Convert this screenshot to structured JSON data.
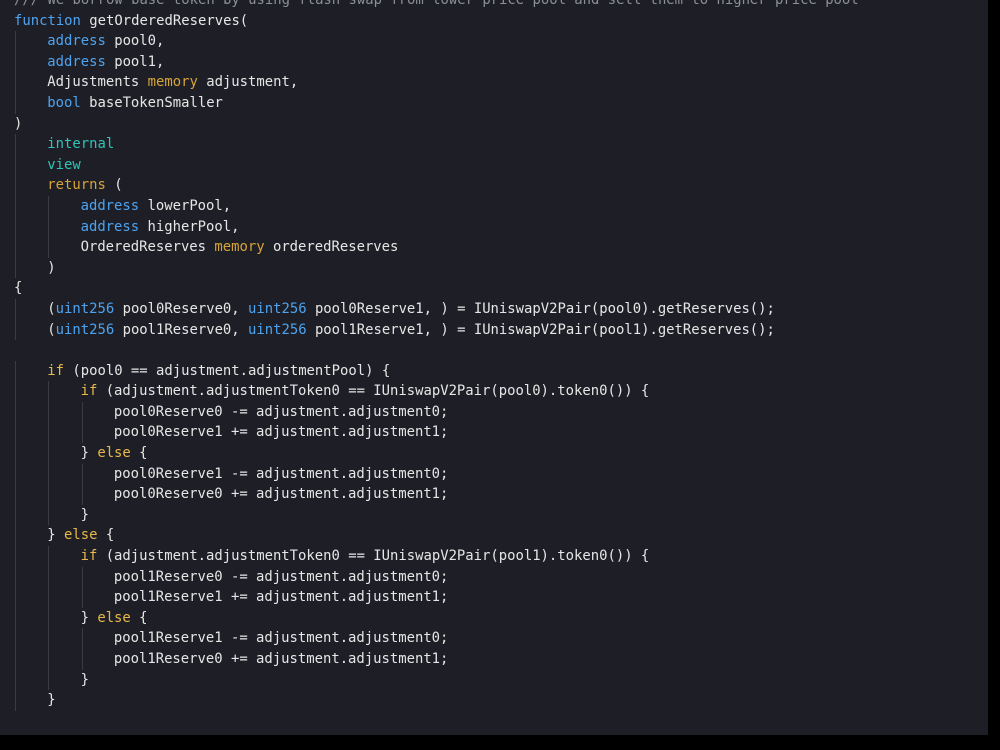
{
  "editor": {
    "language": "Solidity",
    "colors": {
      "background": "#1e1f26",
      "plain": "#e6e6e6",
      "comment": "#8a8f98",
      "function_keyword": "#4da3f0",
      "type_keyword": "#4da3f0",
      "memory_keyword": "#d6a43a",
      "visibility_keyword": "#2ec4b6",
      "control_keyword": "#e8b84a"
    },
    "lines": [
      {
        "indent": 0,
        "tokens": [
          {
            "t": "/// We borrow base token by using flash swap from lower price pool and sell them to higher price pool",
            "c": "comment"
          }
        ]
      },
      {
        "indent": 0,
        "tokens": [
          {
            "t": "function",
            "c": "fn"
          },
          {
            "t": " getOrderedReserves(",
            "c": "plain"
          }
        ]
      },
      {
        "indent": 1,
        "tokens": [
          {
            "t": "address",
            "c": "type"
          },
          {
            "t": " pool0,",
            "c": "plain"
          }
        ]
      },
      {
        "indent": 1,
        "tokens": [
          {
            "t": "address",
            "c": "type"
          },
          {
            "t": " pool1,",
            "c": "plain"
          }
        ]
      },
      {
        "indent": 1,
        "tokens": [
          {
            "t": "Adjustments ",
            "c": "plain"
          },
          {
            "t": "memory",
            "c": "mem"
          },
          {
            "t": " adjustment,",
            "c": "plain"
          }
        ]
      },
      {
        "indent": 1,
        "tokens": [
          {
            "t": "bool",
            "c": "type"
          },
          {
            "t": " baseTokenSmaller",
            "c": "plain"
          }
        ]
      },
      {
        "indent": 0,
        "tokens": [
          {
            "t": ")",
            "c": "plain"
          }
        ]
      },
      {
        "indent": 1,
        "tokens": [
          {
            "t": "internal",
            "c": "vis"
          }
        ]
      },
      {
        "indent": 1,
        "tokens": [
          {
            "t": "view",
            "c": "vis"
          }
        ]
      },
      {
        "indent": 1,
        "tokens": [
          {
            "t": "returns",
            "c": "ret"
          },
          {
            "t": " (",
            "c": "plain"
          }
        ]
      },
      {
        "indent": 2,
        "tokens": [
          {
            "t": "address",
            "c": "type"
          },
          {
            "t": " lowerPool,",
            "c": "plain"
          }
        ]
      },
      {
        "indent": 2,
        "tokens": [
          {
            "t": "address",
            "c": "type"
          },
          {
            "t": " higherPool,",
            "c": "plain"
          }
        ]
      },
      {
        "indent": 2,
        "tokens": [
          {
            "t": "OrderedReserves ",
            "c": "plain"
          },
          {
            "t": "memory",
            "c": "mem"
          },
          {
            "t": " orderedReserves",
            "c": "plain"
          }
        ]
      },
      {
        "indent": 1,
        "tokens": [
          {
            "t": ")",
            "c": "plain"
          }
        ]
      },
      {
        "indent": 0,
        "tokens": [
          {
            "t": "{",
            "c": "plain"
          }
        ]
      },
      {
        "indent": 1,
        "tokens": [
          {
            "t": "(",
            "c": "plain"
          },
          {
            "t": "uint256",
            "c": "type"
          },
          {
            "t": " pool0Reserve0, ",
            "c": "plain"
          },
          {
            "t": "uint256",
            "c": "type"
          },
          {
            "t": " pool0Reserve1, ) = IUniswapV2Pair(pool0).getReserves();",
            "c": "plain"
          }
        ]
      },
      {
        "indent": 1,
        "tokens": [
          {
            "t": "(",
            "c": "plain"
          },
          {
            "t": "uint256",
            "c": "type"
          },
          {
            "t": " pool1Reserve0, ",
            "c": "plain"
          },
          {
            "t": "uint256",
            "c": "type"
          },
          {
            "t": " pool1Reserve1, ) = IUniswapV2Pair(pool1).getReserves();",
            "c": "plain"
          }
        ]
      },
      {
        "indent": 0,
        "tokens": []
      },
      {
        "indent": 1,
        "tokens": [
          {
            "t": "if",
            "c": "kw"
          },
          {
            "t": " (pool0 == adjustment.adjustmentPool) {",
            "c": "plain"
          }
        ]
      },
      {
        "indent": 2,
        "tokens": [
          {
            "t": "if",
            "c": "kw"
          },
          {
            "t": " (adjustment.adjustmentToken0 == IUniswapV2Pair(pool0).token0()) {",
            "c": "plain"
          }
        ]
      },
      {
        "indent": 3,
        "tokens": [
          {
            "t": "pool0Reserve0 -= adjustment.adjustment0;",
            "c": "plain"
          }
        ]
      },
      {
        "indent": 3,
        "tokens": [
          {
            "t": "pool0Reserve1 += adjustment.adjustment1;",
            "c": "plain"
          }
        ]
      },
      {
        "indent": 2,
        "tokens": [
          {
            "t": "} ",
            "c": "plain"
          },
          {
            "t": "else",
            "c": "kw"
          },
          {
            "t": " {",
            "c": "plain"
          }
        ]
      },
      {
        "indent": 3,
        "tokens": [
          {
            "t": "pool0Reserve1 -= adjustment.adjustment0;",
            "c": "plain"
          }
        ]
      },
      {
        "indent": 3,
        "tokens": [
          {
            "t": "pool0Reserve0 += adjustment.adjustment1;",
            "c": "plain"
          }
        ]
      },
      {
        "indent": 2,
        "tokens": [
          {
            "t": "}",
            "c": "plain"
          }
        ]
      },
      {
        "indent": 1,
        "tokens": [
          {
            "t": "} ",
            "c": "plain"
          },
          {
            "t": "else",
            "c": "kw"
          },
          {
            "t": " {",
            "c": "plain"
          }
        ]
      },
      {
        "indent": 2,
        "tokens": [
          {
            "t": "if",
            "c": "kw"
          },
          {
            "t": " (adjustment.adjustmentToken0 == IUniswapV2Pair(pool1).token0()) {",
            "c": "plain"
          }
        ]
      },
      {
        "indent": 3,
        "tokens": [
          {
            "t": "pool1Reserve0 -= adjustment.adjustment0;",
            "c": "plain"
          }
        ]
      },
      {
        "indent": 3,
        "tokens": [
          {
            "t": "pool1Reserve1 += adjustment.adjustment1;",
            "c": "plain"
          }
        ]
      },
      {
        "indent": 2,
        "tokens": [
          {
            "t": "} ",
            "c": "plain"
          },
          {
            "t": "else",
            "c": "kw"
          },
          {
            "t": " {",
            "c": "plain"
          }
        ]
      },
      {
        "indent": 3,
        "tokens": [
          {
            "t": "pool1Reserve1 -= adjustment.adjustment0;",
            "c": "plain"
          }
        ]
      },
      {
        "indent": 3,
        "tokens": [
          {
            "t": "pool1Reserve0 += adjustment.adjustment1;",
            "c": "plain"
          }
        ]
      },
      {
        "indent": 2,
        "tokens": [
          {
            "t": "}",
            "c": "plain"
          }
        ]
      },
      {
        "indent": 1,
        "tokens": [
          {
            "t": "}",
            "c": "plain"
          }
        ]
      },
      {
        "indent": 0,
        "tokens": []
      }
    ]
  }
}
